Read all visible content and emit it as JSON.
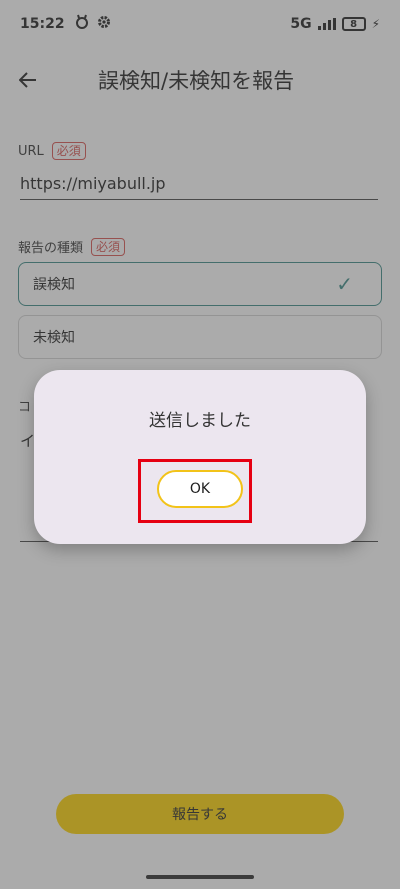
{
  "status_bar": {
    "time": "15:22",
    "network": "5G",
    "battery": "8"
  },
  "app_bar": {
    "back_icon": "arrow-left-icon",
    "title": "誤検知/未検知を報告"
  },
  "form": {
    "url_label": "URL",
    "required_label": "必須",
    "url_value": "https://miyabull.jp",
    "report_type_label": "報告の種類",
    "options": [
      {
        "label": "誤検知",
        "selected": true
      },
      {
        "label": "未検知",
        "selected": false
      }
    ],
    "comment_label_partial": "コ",
    "comment_value_partial": "イ"
  },
  "submit_button": {
    "label": "報告する",
    "color": "#ffd400"
  },
  "dialog": {
    "message": "送信しました",
    "ok_label": "OK",
    "highlight_color": "#e60012"
  }
}
